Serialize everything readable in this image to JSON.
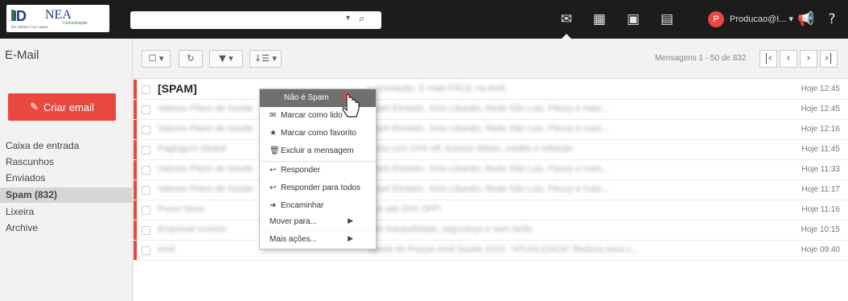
{
  "colors": {
    "accent": "#e9483f",
    "topbar": "#1c1c1c"
  },
  "logo": {
    "mark": "ID",
    "name": "NEA",
    "sub": "Comunicação",
    "tagline": "Ser idôneo é ser capaz."
  },
  "search": {
    "placeholder": "",
    "value": ""
  },
  "topbar": {
    "icons": [
      "mail-icon",
      "calendar-icon",
      "contacts-icon",
      "tasks-icon"
    ],
    "avatar_letter": "P",
    "account": "Producao@I... ▾"
  },
  "sidebar": {
    "title": "E-Mail",
    "compose_label": "Criar email",
    "folders": [
      "Caixa de entrada",
      "Rascunhos",
      "Enviados",
      "Spam (832)",
      "Lixeira",
      "Archive"
    ]
  },
  "toolbar": {
    "pagination": "Mensagens 1 - 50 de 832",
    "sort_label": "↓☰ ▾"
  },
  "messages": [
    {
      "sender": "[SPAM]",
      "subject": "a simulação. É mais FÁCIL na Amil.",
      "time": "Hoje 12:45"
    },
    {
      "sender": "Valoreo Plano de Saúde",
      "subject": "Albert Einstein, Sírio Libanês, Rede São Luiz, Fleury e mais...",
      "time": "Hoje 12:45"
    },
    {
      "sender": "Valoreo Plano de Saúde",
      "subject": "Albert Einstein, Sírio Libanês, Rede São Luiz, Fleury e mais...",
      "time": "Hoje 12:16"
    },
    {
      "sender": "Pagloguro Global",
      "subject": "Linha com 14% off, Acesso débito, crédito e refeição",
      "time": "Hoje 11:45"
    },
    {
      "sender": "Valoreo Plano de Saúde",
      "subject": "Albert Einstein, Sírio Libanês, Rede São Luiz, Fleury e mais...",
      "time": "Hoje 11:33"
    },
    {
      "sender": "Valoreo Plano de Saúde",
      "subject": "Albert Einstein, Sírio Libanês, Rede São Luiz, Fleury e mais...",
      "time": "Hoje 11:17"
    },
    {
      "sender": "Preco Store",
      "subject": "com até 20% OFF!",
      "time": "Hoje 11:16"
    },
    {
      "sender": "Empresal Investe",
      "subject": "com tranquilidade, segurança e sem tarifa",
      "time": "Hoje 10:15"
    },
    {
      "sender": "Amil",
      "subject": "Tabela de Preços Amil Saúde 2019. *ATUALIZADA* Reduza seus c...",
      "time": "Hoje 09:40"
    }
  ],
  "context_menu": {
    "items": [
      {
        "label": "Não é Spam",
        "icon": ""
      },
      {
        "label": "Marcar como lido",
        "icon": "envelope-open-icon"
      },
      {
        "label": "Marcar como favorito",
        "icon": "star-icon"
      },
      {
        "label": "Excluir a mensagem",
        "icon": "trash-icon"
      },
      {
        "label": "Responder",
        "icon": "reply-icon"
      },
      {
        "label": "Responder para todos",
        "icon": "reply-all-icon"
      },
      {
        "label": "Encaminhar",
        "icon": "forward-icon"
      },
      {
        "label": "Mover para...",
        "icon": ""
      },
      {
        "label": "Mais ações...",
        "icon": ""
      }
    ]
  }
}
